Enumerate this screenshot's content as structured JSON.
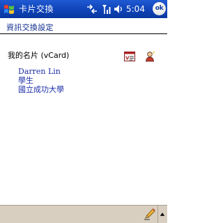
{
  "status_bar": {
    "app_title": "卡片交換",
    "clock": "5:04",
    "ok_label": "ok",
    "icons": [
      "windows-start-icon",
      "connectivity-icon",
      "signal-icon",
      "volume-icon"
    ]
  },
  "page": {
    "title": "資訊交換設定"
  },
  "my_card": {
    "label": "我的名片 (vCard)",
    "name": "Darren Lin",
    "role": "學生",
    "organization": "國立成功大學",
    "icons": [
      "vcard-icon",
      "contact-card-icon"
    ]
  },
  "menu_bar": {
    "icons": [
      "pencil-input-icon",
      "input-menu-arrow-icon"
    ]
  },
  "colors": {
    "title_bar": "#0f43b8",
    "link_text": "#1d2fa8",
    "header_text": "#0b2a8c",
    "menu_bar": "#d9cfc1"
  }
}
